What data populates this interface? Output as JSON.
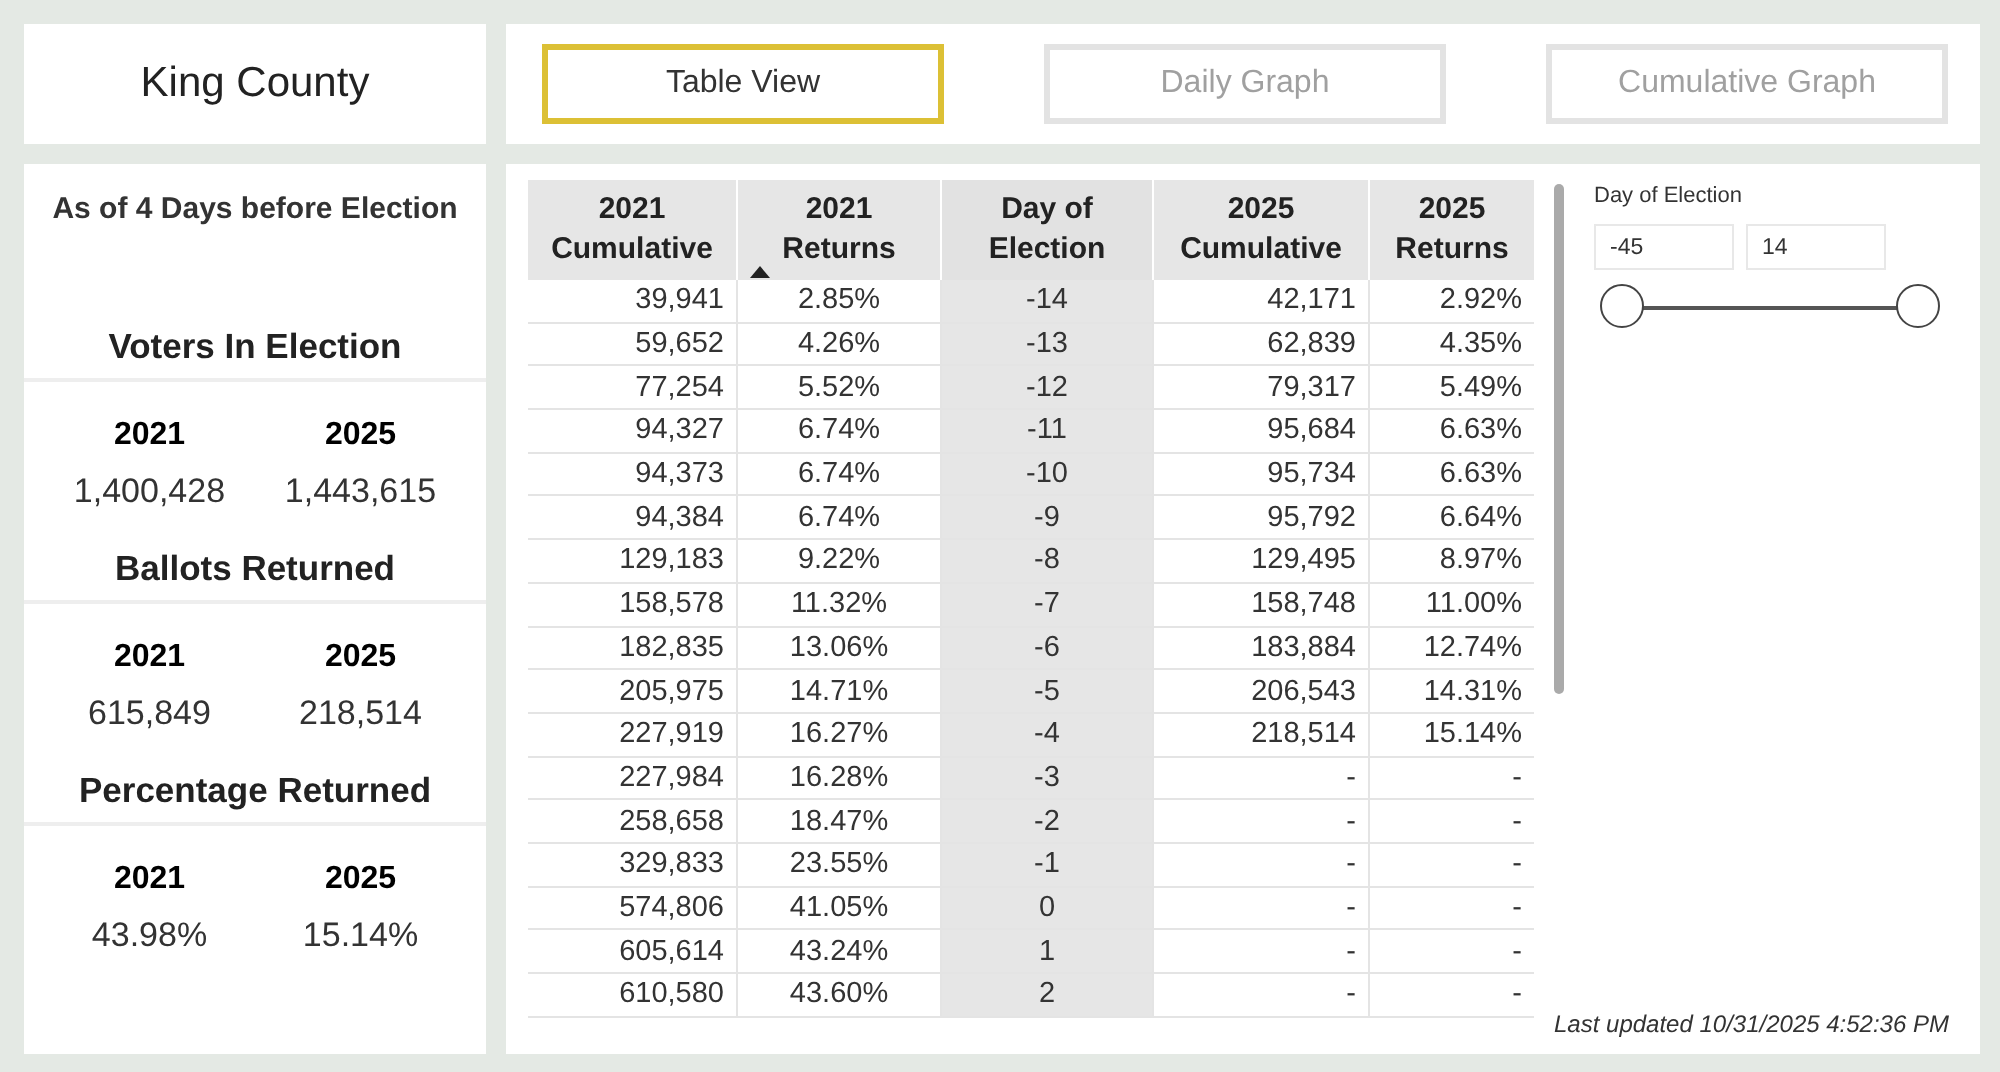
{
  "title": "King County",
  "views": [
    {
      "label": "Table View",
      "selected": true
    },
    {
      "label": "Daily Graph",
      "selected": false
    },
    {
      "label": "Cumulative Graph",
      "selected": false
    }
  ],
  "summary": {
    "heading": "As of 4 Days before Election",
    "sections": [
      {
        "title": "Voters In Election",
        "years": [
          "2021",
          "2025"
        ],
        "values": [
          "1,400,428",
          "1,443,615"
        ]
      },
      {
        "title": "Ballots Returned",
        "years": [
          "2021",
          "2025"
        ],
        "values": [
          "615,849",
          "218,514"
        ]
      },
      {
        "title": "Percentage Returned",
        "years": [
          "2021",
          "2025"
        ],
        "values": [
          "43.98%",
          "15.14%"
        ]
      }
    ]
  },
  "table": {
    "columns": [
      {
        "label": "2021 Cumulative",
        "sorted": false,
        "shaded": false
      },
      {
        "label": "2021 Returns",
        "sorted": true,
        "shaded": false
      },
      {
        "label": "Day of Election",
        "sorted": false,
        "shaded": true
      },
      {
        "label": "2025 Cumulative",
        "sorted": false,
        "shaded": false
      },
      {
        "label": "2025 Returns",
        "sorted": false,
        "shaded": false
      }
    ],
    "rows": [
      [
        "39,941",
        "2.85%",
        "-14",
        "42,171",
        "2.92%"
      ],
      [
        "59,652",
        "4.26%",
        "-13",
        "62,839",
        "4.35%"
      ],
      [
        "77,254",
        "5.52%",
        "-12",
        "79,317",
        "5.49%"
      ],
      [
        "94,327",
        "6.74%",
        "-11",
        "95,684",
        "6.63%"
      ],
      [
        "94,373",
        "6.74%",
        "-10",
        "95,734",
        "6.63%"
      ],
      [
        "94,384",
        "6.74%",
        "-9",
        "95,792",
        "6.64%"
      ],
      [
        "129,183",
        "9.22%",
        "-8",
        "129,495",
        "8.97%"
      ],
      [
        "158,578",
        "11.32%",
        "-7",
        "158,748",
        "11.00%"
      ],
      [
        "182,835",
        "13.06%",
        "-6",
        "183,884",
        "12.74%"
      ],
      [
        "205,975",
        "14.71%",
        "-5",
        "206,543",
        "14.31%"
      ],
      [
        "227,919",
        "16.27%",
        "-4",
        "218,514",
        "15.14%"
      ],
      [
        "227,984",
        "16.28%",
        "-3",
        "-",
        "-"
      ],
      [
        "258,658",
        "18.47%",
        "-2",
        "-",
        "-"
      ],
      [
        "329,833",
        "23.55%",
        "-1",
        "-",
        "-"
      ],
      [
        "574,806",
        "41.05%",
        "0",
        "-",
        "-"
      ],
      [
        "605,614",
        "43.24%",
        "1",
        "-",
        "-"
      ],
      [
        "610,580",
        "43.60%",
        "2",
        "-",
        "-"
      ]
    ]
  },
  "filter": {
    "label": "Day of Election",
    "min": "-45",
    "max": "14",
    "thumbs": [
      {
        "level": 0
      },
      {
        "level": 1
      }
    ]
  },
  "last_updated": "Last updated 10/31/2025 4:52:36 PM"
}
